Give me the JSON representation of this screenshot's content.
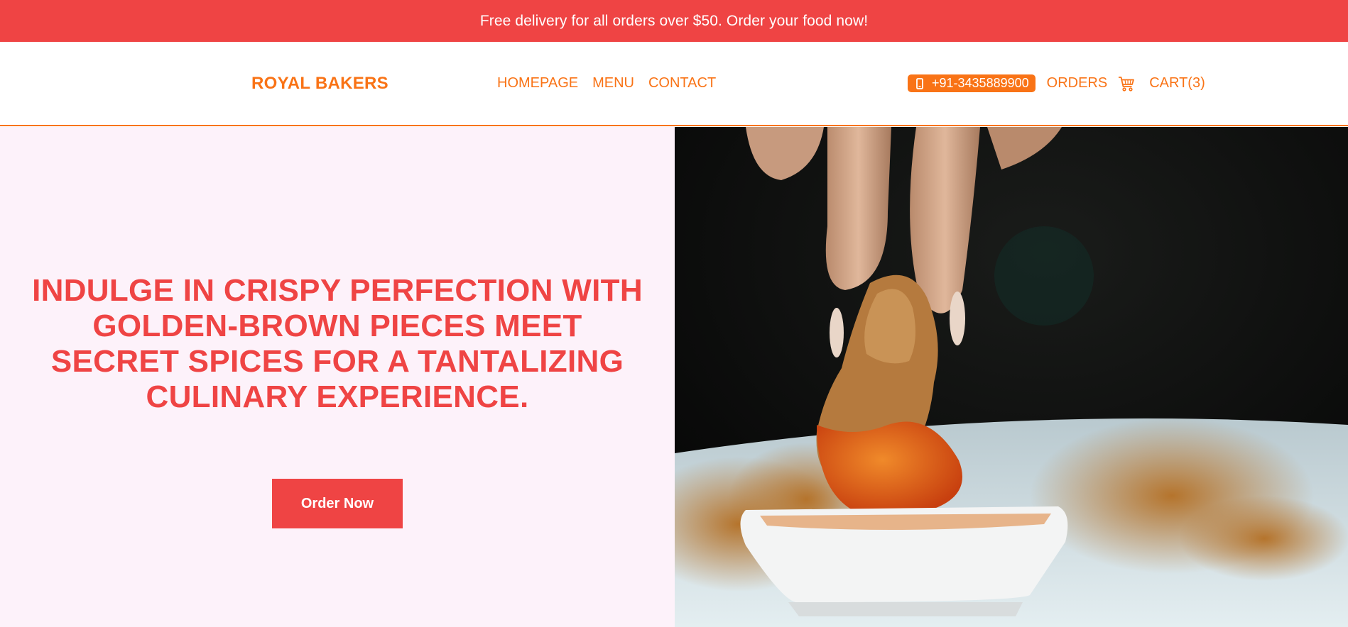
{
  "announcement": {
    "text": "Free delivery for all orders over $50. Order your food now!"
  },
  "header": {
    "brand": "ROYAL BAKERS",
    "nav": [
      {
        "label": "HOMEPAGE"
      },
      {
        "label": "MENU"
      },
      {
        "label": "CONTACT"
      }
    ],
    "phone": {
      "icon": "phone-icon",
      "number": "+91-3435889900"
    },
    "orders_label": "ORDERS",
    "cart": {
      "icon": "cart-icon",
      "label": "CART(3)"
    }
  },
  "hero": {
    "title": "INDULGE IN CRISPY PERFECTION WITH GOLDEN-BROWN PIECES MEET SECRET SPICES FOR A TANTALIZING CULINARY EXPERIENCE.",
    "cta_label": "Order Now",
    "image": "hand-dipping-fried-chicken-into-sauce-photo"
  },
  "colors": {
    "accent_red": "#ef4444",
    "accent_orange": "#f97316",
    "hero_bg": "#fdf2fa"
  }
}
